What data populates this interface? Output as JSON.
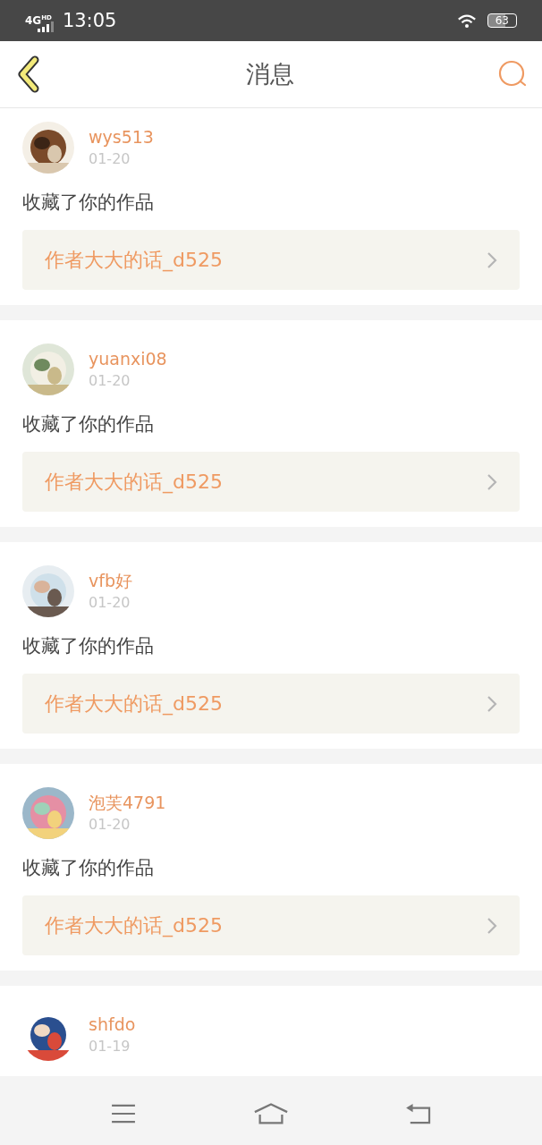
{
  "status_bar": {
    "network": "4G",
    "network_badge": "HD",
    "time": "13:05",
    "battery": "63"
  },
  "header": {
    "title": "消息"
  },
  "messages": [
    {
      "name": "wys513",
      "date": "01-20",
      "action": "收藏了你的作品",
      "link": "作者大大的话_d525"
    },
    {
      "name": "yuanxi08",
      "date": "01-20",
      "action": "收藏了你的作品",
      "link": "作者大大的话_d525"
    },
    {
      "name": "vfb好",
      "date": "01-20",
      "action": "收藏了你的作品",
      "link": "作者大大的话_d525"
    },
    {
      "name": "泡芙4791",
      "date": "01-20",
      "action": "收藏了你的作品",
      "link": "作者大大的话_d525"
    },
    {
      "name": "shfdo",
      "date": "01-19"
    }
  ]
}
